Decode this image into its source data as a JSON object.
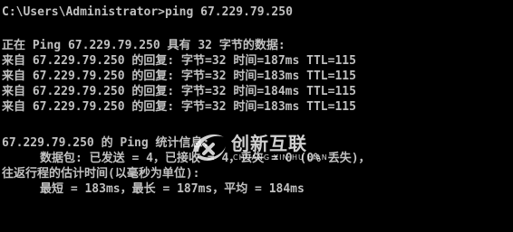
{
  "window": {
    "background": "#000000",
    "text_color": "#c0c0c0"
  },
  "console": {
    "prompt_line": "C:\\Users\\Administrator>ping 67.229.79.250",
    "ping_header": "正在 Ping 67.229.79.250 具有 32 字节的数据:",
    "replies": [
      "来自 67.229.79.250 的回复: 字节=32 时间=187ms TTL=115",
      "来自 67.229.79.250 的回复: 字节=32 时间=183ms TTL=115",
      "来自 67.229.79.250 的回复: 字节=32 时间=184ms TTL=115",
      "来自 67.229.79.250 的回复: 字节=32 时间=183ms TTL=115"
    ],
    "stats_header": "67.229.79.250 的 Ping 统计信息:",
    "packets_line": "数据包: 已发送 = 4，已接收 = 4，丢失 = 0 (0% 丢失)，",
    "rtt_header": "往返行程的估计时间(以毫秒为单位):",
    "rtt_values": "最短 = 183ms，最长 = 187ms，平均 = 184ms"
  },
  "watermark": {
    "name_cn": "创新互联",
    "name_en": "CHUANG XIN HU LIAN",
    "icon": "logo-swoosh-icon",
    "accent_color": "#ffffff"
  }
}
